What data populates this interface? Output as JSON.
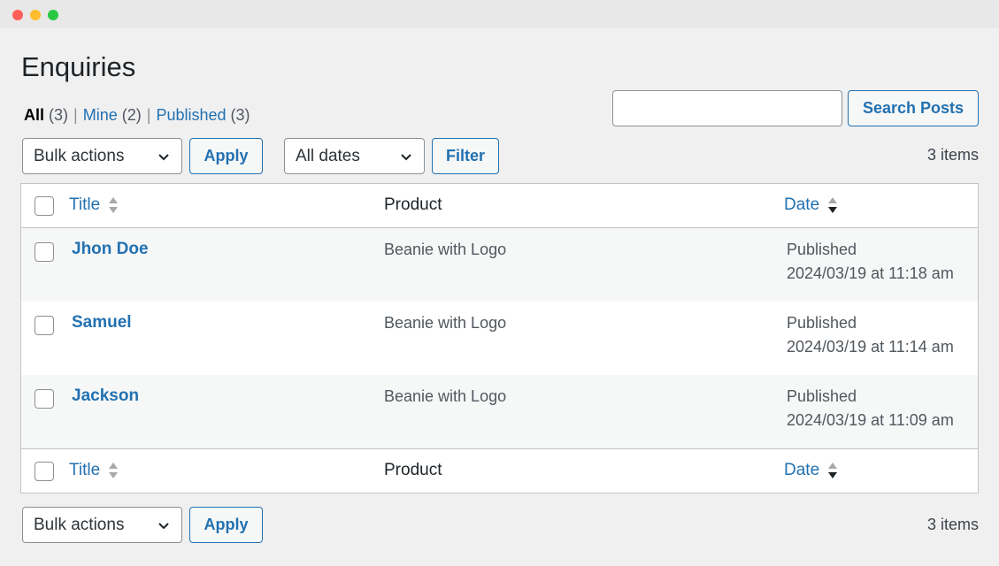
{
  "page": {
    "title": "Enquiries"
  },
  "views": {
    "all_label": "All",
    "all_count": "(3)",
    "mine_label": "Mine",
    "mine_count": "(2)",
    "published_label": "Published",
    "published_count": "(3)",
    "separator": "|"
  },
  "search": {
    "value": "",
    "button_label": "Search Posts"
  },
  "toolbar_top": {
    "bulk_actions": "Bulk actions",
    "apply_label": "Apply",
    "dates_filter": "All dates",
    "filter_label": "Filter",
    "items_count": "3 items"
  },
  "table": {
    "columns": {
      "title": "Title",
      "product": "Product",
      "date": "Date"
    },
    "rows": [
      {
        "name": "Jhon Doe",
        "product": "Beanie with Logo",
        "status": "Published",
        "datetime": "2024/03/19 at 11:18 am"
      },
      {
        "name": "Samuel",
        "product": "Beanie with Logo",
        "status": "Published",
        "datetime": "2024/03/19 at 11:14 am"
      },
      {
        "name": "Jackson",
        "product": "Beanie with Logo",
        "status": "Published",
        "datetime": "2024/03/19 at 11:09 am"
      }
    ]
  },
  "toolbar_bottom": {
    "bulk_actions": "Bulk actions",
    "apply_label": "Apply",
    "items_count": "3 items"
  },
  "colors": {
    "link": "#2271b1",
    "background": "#f0f0f1",
    "row_alt": "#f6f7f7"
  },
  "icons": {
    "select_chevron": "chevron-down-icon",
    "sort_title": "sort-icon",
    "sort_date": "sort-desc-icon"
  }
}
